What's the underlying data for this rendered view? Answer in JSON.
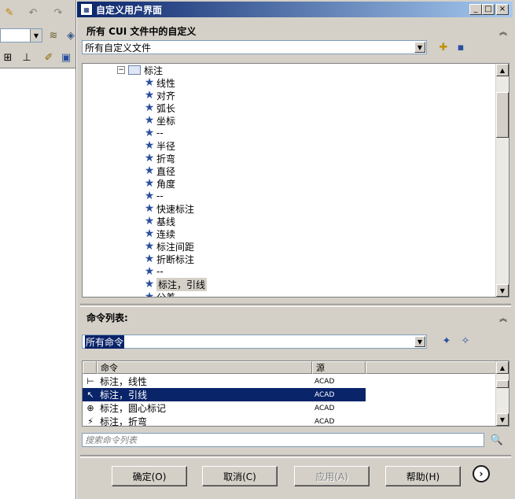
{
  "dialog": {
    "title": "自定义用户界面",
    "minimize": "_",
    "maximize": "□",
    "close": "×"
  },
  "cui_section": {
    "header": "所有 CUI 文件中的自定义",
    "collapse_glyph": "︽",
    "file_combo_value": "所有自定义文件"
  },
  "tree": {
    "parent_label": "标注",
    "items": [
      "线性",
      "对齐",
      "弧长",
      "坐标",
      "--",
      "半径",
      "折弯",
      "直径",
      "角度",
      "--",
      "快速标注",
      "基线",
      "连续",
      "标注间距",
      "折断标注",
      "--",
      "标注，引线",
      "公差"
    ],
    "selected_index": 16
  },
  "commands": {
    "header": "命令列表:",
    "collapse_glyph": "︽",
    "filter_value": "所有命令",
    "col_command": "命令",
    "col_source": "源",
    "rows": [
      {
        "name": "标注，线性",
        "source": "ACAD",
        "icon": "dim-linear-icon",
        "glyph": "⊢"
      },
      {
        "name": "标注，引线",
        "source": "ACAD",
        "icon": "dim-leader-icon",
        "glyph": "↖",
        "selected": true
      },
      {
        "name": "标注，圆心标记",
        "source": "ACAD",
        "icon": "center-mark-icon",
        "glyph": "⊕"
      },
      {
        "name": "标注，折弯",
        "source": "ACAD",
        "icon": "dim-jogged-icon",
        "glyph": "⚡"
      }
    ],
    "search_placeholder": "搜索命令列表"
  },
  "buttons": {
    "ok": "确定(O)",
    "cancel": "取消(C)",
    "apply": "应用(A)",
    "help": "帮助(H)",
    "expand": "›"
  },
  "colors": {
    "title_start": "#0a246a",
    "title_end": "#a6caf0",
    "selection": "#0a246a",
    "star": "#2a4f9e",
    "dialog_bg": "#d4d0c8"
  }
}
